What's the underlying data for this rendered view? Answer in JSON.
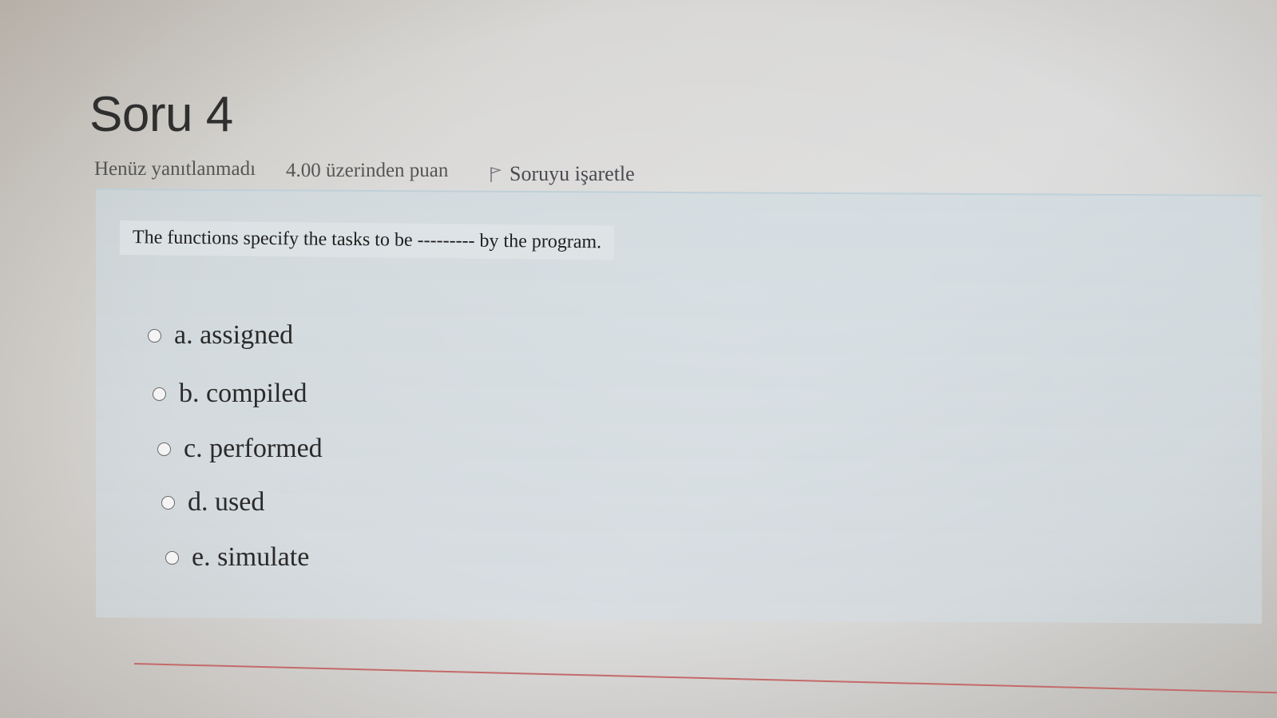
{
  "question": {
    "title": "Soru 4",
    "status": "Henüz yanıtlanmadı",
    "grade": "4.00 üzerinden puan",
    "flag_label": "Soruyu işaretle",
    "text": "The functions specify the tasks to be --------- by the program.",
    "options": [
      {
        "label": "a. assigned",
        "selected": false
      },
      {
        "label": "b. compiled",
        "selected": false
      },
      {
        "label": "c. performed",
        "selected": false
      },
      {
        "label": "d. used",
        "selected": false
      },
      {
        "label": "e. simulate",
        "selected": false
      }
    ]
  },
  "icons": {
    "flag": "flag-icon",
    "radio": "radio-unchecked"
  },
  "colors": {
    "question_box": "#d2dee6",
    "divider": "#c46a6a"
  }
}
